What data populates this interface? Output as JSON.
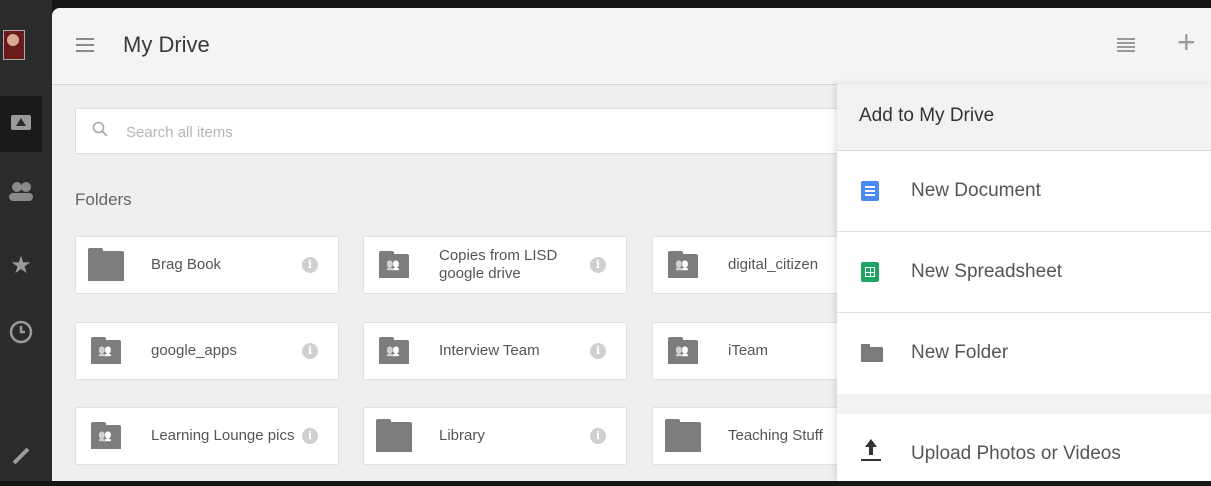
{
  "header": {
    "title": "My Drive",
    "menu_icon": "hamburger-icon",
    "list_view_icon": "list-view-icon",
    "add_icon": "plus-icon"
  },
  "rail": {
    "items": [
      "drive-icon",
      "people-icon",
      "star-icon",
      "clock-icon",
      "link-icon"
    ]
  },
  "search": {
    "placeholder": "Search all items",
    "value": ""
  },
  "folders_section": {
    "title": "Folders",
    "items": [
      {
        "name": "Brag Book",
        "shared": false
      },
      {
        "name": "Copies from LISD google drive",
        "shared": true
      },
      {
        "name": "digital_citizen",
        "shared": true
      },
      {
        "name": "google_apps",
        "shared": true
      },
      {
        "name": "Interview Team",
        "shared": true
      },
      {
        "name": "iTeam",
        "shared": true
      },
      {
        "name": "Learning Lounge pics",
        "shared": true
      },
      {
        "name": "Library",
        "shared": false
      },
      {
        "name": "Teaching Stuff",
        "shared": false
      }
    ]
  },
  "add_menu": {
    "title": "Add to My Drive",
    "items": [
      {
        "label": "New Document",
        "icon": "document-icon"
      },
      {
        "label": "New Spreadsheet",
        "icon": "spreadsheet-icon"
      },
      {
        "label": "New Folder",
        "icon": "folder-icon"
      },
      {
        "label": "Upload Photos or Videos",
        "icon": "upload-icon"
      }
    ]
  },
  "colors": {
    "doc_blue": "#4a8af4",
    "sheet_green": "#1fa463",
    "folder_grey": "#7d7d7d"
  }
}
